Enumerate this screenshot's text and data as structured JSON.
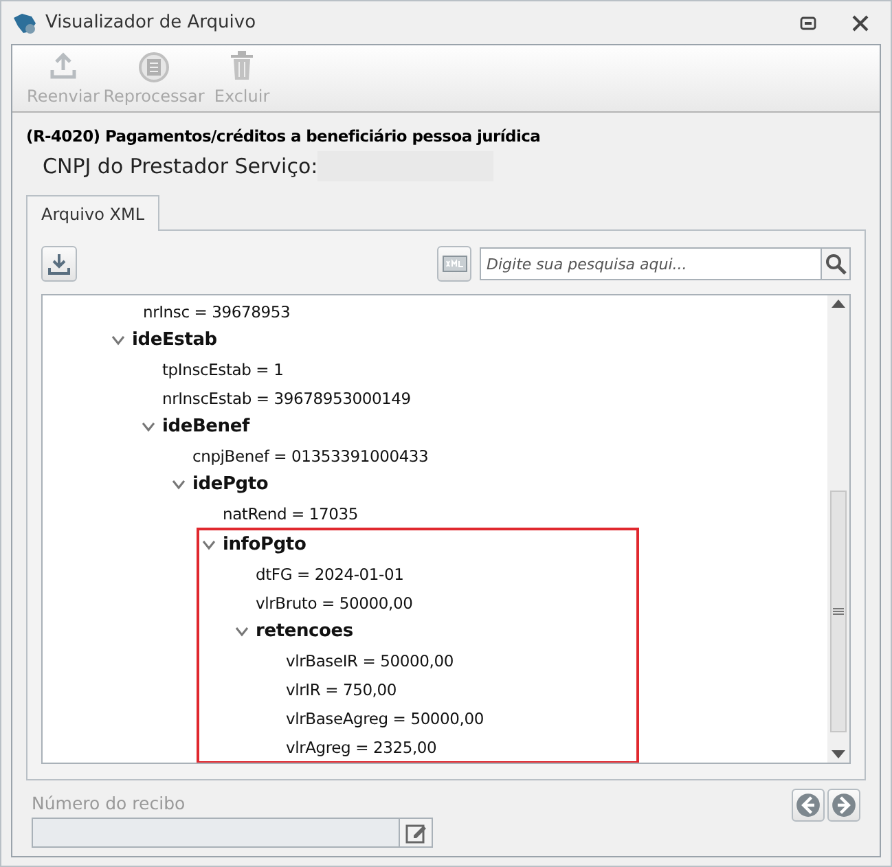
{
  "window": {
    "title": "Visualizador de Arquivo"
  },
  "toolbar": [
    {
      "label": "Reenviar",
      "kind": "upload",
      "disabled": true
    },
    {
      "label": "Reprocessar",
      "kind": "calc",
      "disabled": true
    },
    {
      "label": "Excluir",
      "kind": "trash",
      "disabled": true
    }
  ],
  "header": {
    "title": "(R-4020) Pagamentos/créditos a beneficiário pessoa jurídica",
    "cnpj_label": "CNPJ do Prestador Serviço:"
  },
  "tabs": [
    {
      "label": "Arquivo XML",
      "selected": true
    }
  ],
  "search": {
    "placeholder": "Digite sua pesquisa aqui..."
  },
  "tree": {
    "rows_above": [
      {
        "label": "nrInsc = 39678953"
      }
    ],
    "nodes": [
      {
        "label": "ideEstab",
        "expanded": true,
        "children": [
          {
            "label": "tpInscEstab = 1"
          },
          {
            "label": "nrInscEstab = 39678953000149"
          },
          {
            "label": "ideBenef",
            "expanded": true,
            "children": [
              {
                "label": "cnpjBenef = 01353391000433"
              },
              {
                "label": "idePgto",
                "expanded": true,
                "children": [
                  {
                    "label": "natRend = 17035"
                  },
                  {
                    "label": "infoPgto",
                    "expanded": true,
                    "highlighted": true,
                    "children": [
                      {
                        "label": "dtFG = 2024-01-01"
                      },
                      {
                        "label": "vlrBruto = 50000,00"
                      },
                      {
                        "label": "retencoes",
                        "expanded": true,
                        "children": [
                          {
                            "label": "vlrBaseIR = 50000,00"
                          },
                          {
                            "label": "vlrIR = 750,00"
                          },
                          {
                            "label": "vlrBaseAgreg = 50000,00"
                          },
                          {
                            "label": "vlrAgreg = 2325,00"
                          }
                        ]
                      }
                    ]
                  }
                ]
              }
            ]
          }
        ]
      }
    ]
  },
  "receipt": {
    "label": "Número do recibo"
  }
}
